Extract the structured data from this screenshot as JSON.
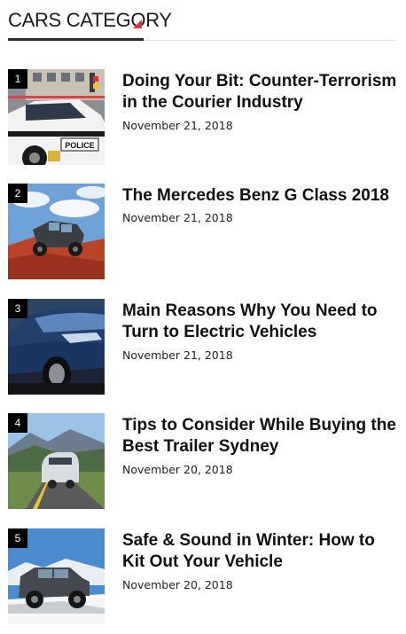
{
  "widget": {
    "title": "CARS CATEGORY",
    "accent_color": "#e0333a",
    "underline_color": "#2b2b3a"
  },
  "posts": [
    {
      "rank": "1",
      "title": "Doing Your Bit: Counter-Terrorism in the Courier Industry",
      "date": "November 21, 2018",
      "thumbnail_icon": "police-car-image"
    },
    {
      "rank": "2",
      "title": "The Mercedes Benz G Class 2018",
      "date": "November 21, 2018",
      "thumbnail_icon": "offroad-jeep-image"
    },
    {
      "rank": "3",
      "title": "Main Reasons Why You Need to Turn to Electric Vehicles",
      "date": "November 21, 2018",
      "thumbnail_icon": "electric-car-image"
    },
    {
      "rank": "4",
      "title": "Tips to Consider While Buying the Best Trailer Sydney",
      "date": "November 20, 2018",
      "thumbnail_icon": "camper-trailer-image"
    },
    {
      "rank": "5",
      "title": "Safe & Sound in Winter: How to Kit Out Your Vehicle",
      "date": "November 20, 2018",
      "thumbnail_icon": "suv-snow-image"
    }
  ]
}
